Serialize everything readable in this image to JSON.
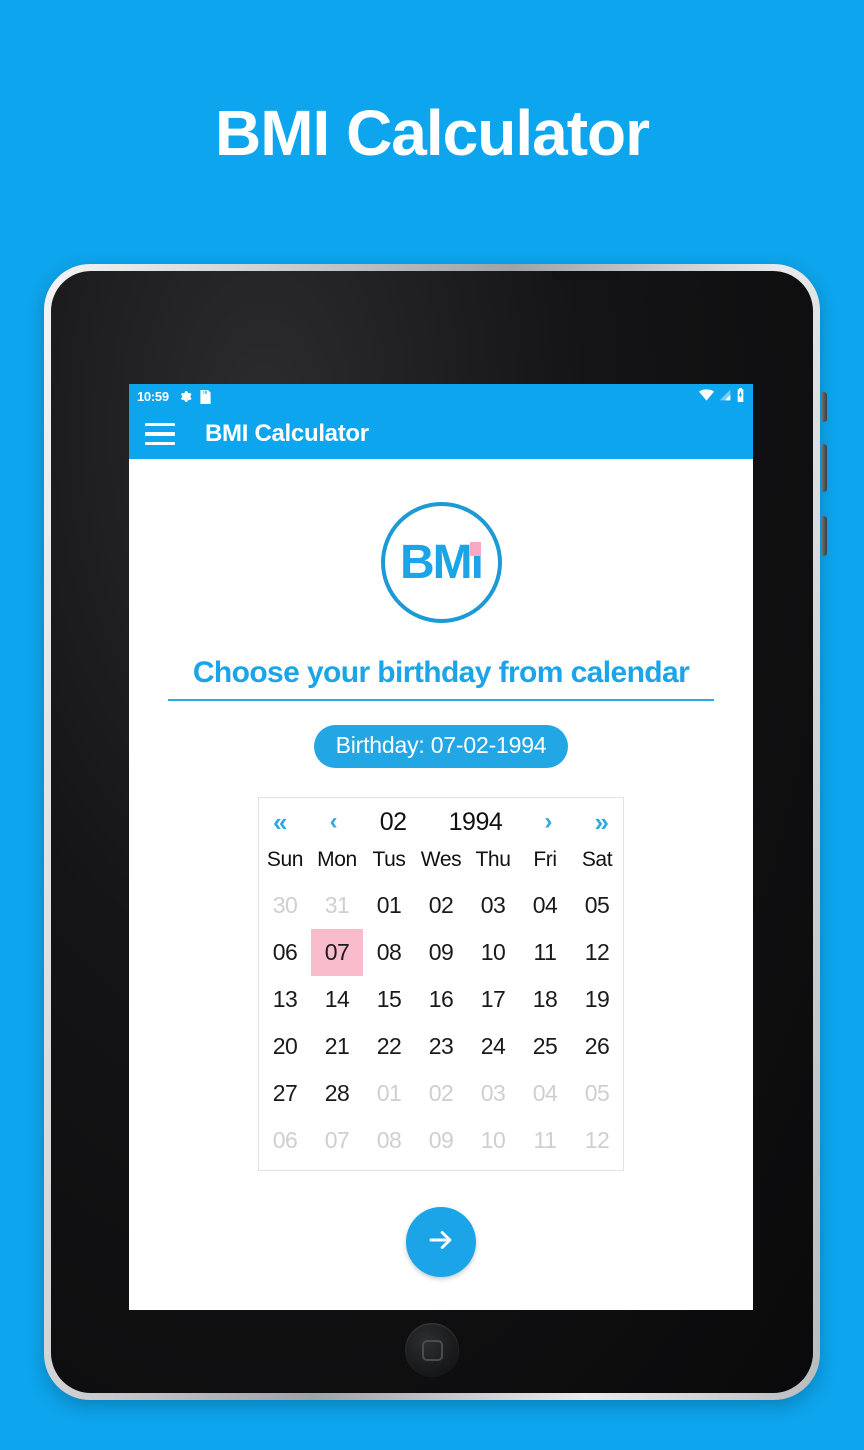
{
  "promo": {
    "title": "BMI Calculator"
  },
  "theme": {
    "background": "#0da5ed",
    "accent": "#1ba5e8",
    "selected_day_bg": "#f9bccd",
    "logo_dot": "#f9a8c4"
  },
  "status_bar": {
    "time": "10:59",
    "icons": [
      "gear-icon",
      "sd-card-icon"
    ],
    "right_icons": [
      "wifi-icon",
      "signal-icon",
      "battery-icon"
    ]
  },
  "app_bar": {
    "menu_icon": "hamburger-menu-icon",
    "title": "BMI Calculator"
  },
  "logo": {
    "text": "BMi",
    "dot": "pink-dot"
  },
  "heading": "Choose your birthday from calendar",
  "birthday_badge": {
    "label": "Birthday: 07-02-1994"
  },
  "calendar": {
    "nav": {
      "prev_year": "«",
      "prev_month": "‹",
      "month": "02",
      "year": "1994",
      "next_month": "›",
      "next_year": "»"
    },
    "day_headers": [
      "Sun",
      "Mon",
      "Tus",
      "Wes",
      "Thu",
      "Fri",
      "Sat"
    ],
    "weeks": [
      [
        {
          "d": "30",
          "muted": true,
          "selected": false
        },
        {
          "d": "31",
          "muted": true,
          "selected": false
        },
        {
          "d": "01",
          "muted": false,
          "selected": false
        },
        {
          "d": "02",
          "muted": false,
          "selected": false
        },
        {
          "d": "03",
          "muted": false,
          "selected": false
        },
        {
          "d": "04",
          "muted": false,
          "selected": false
        },
        {
          "d": "05",
          "muted": false,
          "selected": false
        }
      ],
      [
        {
          "d": "06",
          "muted": false,
          "selected": false
        },
        {
          "d": "07",
          "muted": false,
          "selected": true
        },
        {
          "d": "08",
          "muted": false,
          "selected": false
        },
        {
          "d": "09",
          "muted": false,
          "selected": false
        },
        {
          "d": "10",
          "muted": false,
          "selected": false
        },
        {
          "d": "11",
          "muted": false,
          "selected": false
        },
        {
          "d": "12",
          "muted": false,
          "selected": false
        }
      ],
      [
        {
          "d": "13",
          "muted": false,
          "selected": false
        },
        {
          "d": "14",
          "muted": false,
          "selected": false
        },
        {
          "d": "15",
          "muted": false,
          "selected": false
        },
        {
          "d": "16",
          "muted": false,
          "selected": false
        },
        {
          "d": "17",
          "muted": false,
          "selected": false
        },
        {
          "d": "18",
          "muted": false,
          "selected": false
        },
        {
          "d": "19",
          "muted": false,
          "selected": false
        }
      ],
      [
        {
          "d": "20",
          "muted": false,
          "selected": false
        },
        {
          "d": "21",
          "muted": false,
          "selected": false
        },
        {
          "d": "22",
          "muted": false,
          "selected": false
        },
        {
          "d": "23",
          "muted": false,
          "selected": false
        },
        {
          "d": "24",
          "muted": false,
          "selected": false
        },
        {
          "d": "25",
          "muted": false,
          "selected": false
        },
        {
          "d": "26",
          "muted": false,
          "selected": false
        }
      ],
      [
        {
          "d": "27",
          "muted": false,
          "selected": false
        },
        {
          "d": "28",
          "muted": false,
          "selected": false
        },
        {
          "d": "01",
          "muted": true,
          "selected": false
        },
        {
          "d": "02",
          "muted": true,
          "selected": false
        },
        {
          "d": "03",
          "muted": true,
          "selected": false
        },
        {
          "d": "04",
          "muted": true,
          "selected": false
        },
        {
          "d": "05",
          "muted": true,
          "selected": false
        }
      ],
      [
        {
          "d": "06",
          "muted": true,
          "selected": false
        },
        {
          "d": "07",
          "muted": true,
          "selected": false
        },
        {
          "d": "08",
          "muted": true,
          "selected": false
        },
        {
          "d": "09",
          "muted": true,
          "selected": false
        },
        {
          "d": "10",
          "muted": true,
          "selected": false
        },
        {
          "d": "11",
          "muted": true,
          "selected": false
        },
        {
          "d": "12",
          "muted": true,
          "selected": false
        }
      ]
    ]
  },
  "next_button": {
    "icon": "arrow-right-icon"
  }
}
